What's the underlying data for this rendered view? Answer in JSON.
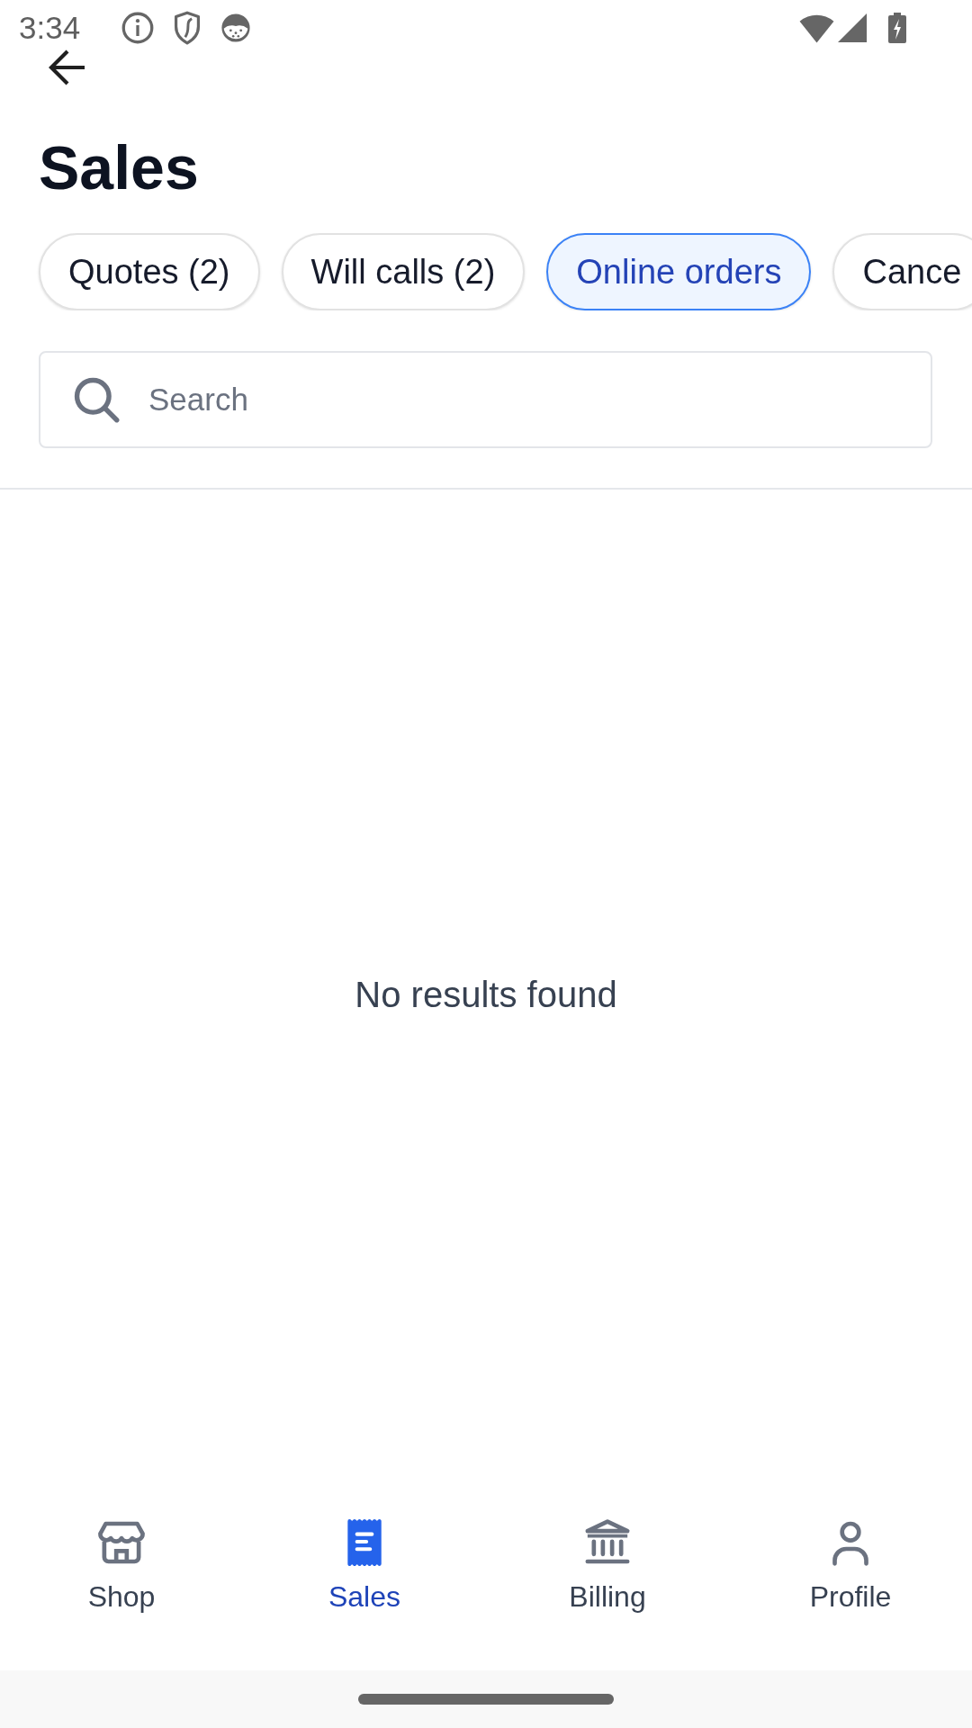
{
  "status_bar": {
    "time": "3:34"
  },
  "header": {
    "title": "Sales"
  },
  "filters": [
    {
      "label": "Quotes (2)",
      "selected": false
    },
    {
      "label": "Will calls (2)",
      "selected": false
    },
    {
      "label": "Online orders",
      "selected": true
    },
    {
      "label": "Cance",
      "selected": false
    }
  ],
  "search": {
    "placeholder": "Search"
  },
  "empty_state": {
    "message": "No results found"
  },
  "bottom_nav": [
    {
      "label": "Shop",
      "selected": false
    },
    {
      "label": "Sales",
      "selected": true
    },
    {
      "label": "Billing",
      "selected": false
    },
    {
      "label": "Profile",
      "selected": false
    }
  ]
}
